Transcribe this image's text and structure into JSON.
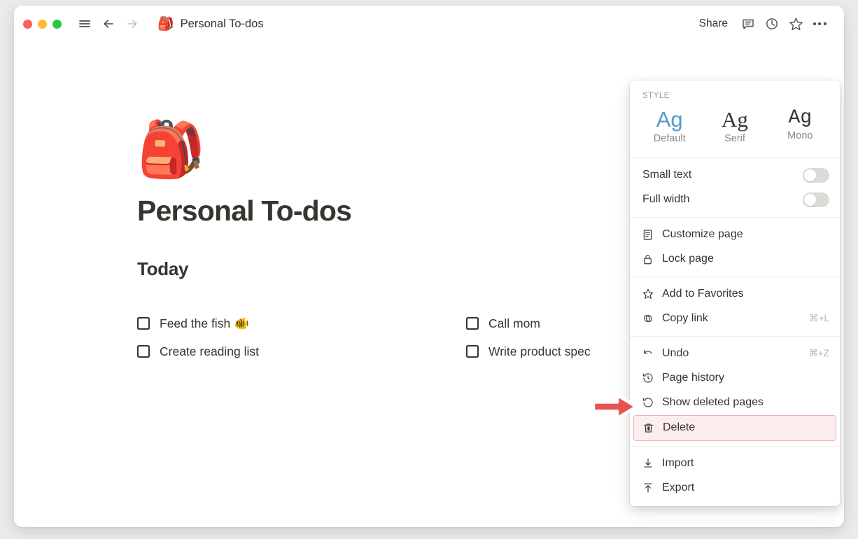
{
  "window": {
    "traffic_lights": [
      "close",
      "minimize",
      "maximize"
    ],
    "page_emoji": "🎒",
    "page_chip_title": "Personal To-dos",
    "share_label": "Share"
  },
  "content": {
    "page_icon": "🎒",
    "title": "Personal To-dos",
    "section_heading": "Today",
    "todos_left": [
      {
        "label": "Feed the fish 🐠",
        "checked": false
      },
      {
        "label": "Create reading list",
        "checked": false
      }
    ],
    "todos_right": [
      {
        "label": "Call mom",
        "checked": false
      },
      {
        "label": "Write product spec",
        "checked": false
      }
    ]
  },
  "menu": {
    "style_label": "STYLE",
    "style_options": [
      {
        "sample": "Ag",
        "name": "Default",
        "active": true
      },
      {
        "sample": "Ag",
        "name": "Serif",
        "active": false
      },
      {
        "sample": "Ag",
        "name": "Mono",
        "active": false
      }
    ],
    "toggles": [
      {
        "label": "Small text",
        "on": false
      },
      {
        "label": "Full width",
        "on": false
      }
    ],
    "group_page": [
      {
        "label": "Customize page",
        "icon": "document-icon",
        "shortcut": ""
      },
      {
        "label": "Lock page",
        "icon": "lock-icon",
        "shortcut": ""
      }
    ],
    "group_links": [
      {
        "label": "Add to Favorites",
        "icon": "star-icon",
        "shortcut": ""
      },
      {
        "label": "Copy link",
        "icon": "link-icon",
        "shortcut": "⌘+L"
      }
    ],
    "group_history": [
      {
        "label": "Undo",
        "icon": "undo-icon",
        "shortcut": "⌘+Z"
      },
      {
        "label": "Page history",
        "icon": "clock-history-icon",
        "shortcut": ""
      },
      {
        "label": "Show deleted pages",
        "icon": "restore-icon",
        "shortcut": ""
      },
      {
        "label": "Delete",
        "icon": "trash-icon",
        "shortcut": "",
        "highlighted": true
      }
    ],
    "group_transfer": [
      {
        "label": "Import",
        "icon": "import-icon",
        "shortcut": ""
      },
      {
        "label": "Export",
        "icon": "export-icon",
        "shortcut": ""
      }
    ]
  },
  "annotation": {
    "type": "arrow",
    "direction": "right",
    "color": "#e8534f",
    "target": "Delete"
  },
  "colors": {
    "accent_blue": "#529ccb",
    "text": "#37352f",
    "muted": "#9b9a97",
    "highlight_bg": "#fdeeee",
    "highlight_border": "#f0b3b3",
    "arrow_red": "#e8534f"
  }
}
